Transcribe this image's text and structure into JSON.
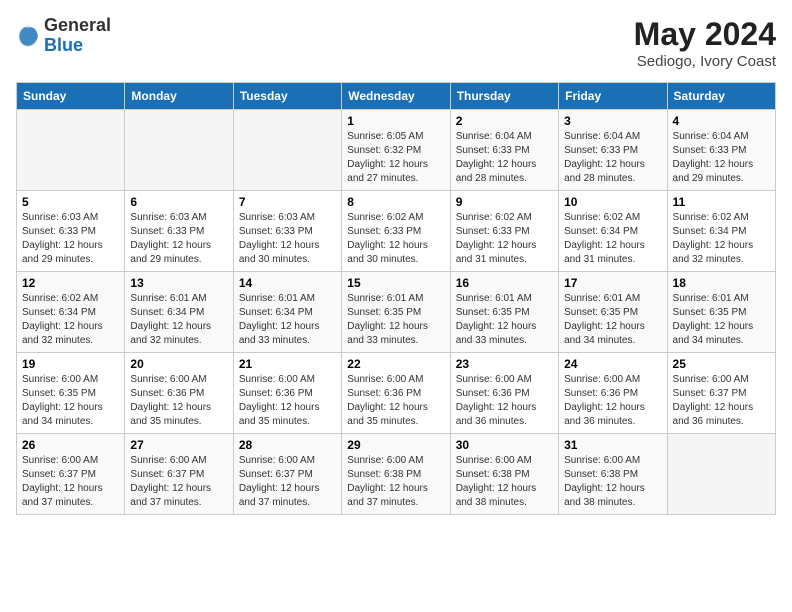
{
  "header": {
    "logo": {
      "general": "General",
      "blue": "Blue"
    },
    "title": "May 2024",
    "location": "Sediogo, Ivory Coast"
  },
  "days_of_week": [
    "Sunday",
    "Monday",
    "Tuesday",
    "Wednesday",
    "Thursday",
    "Friday",
    "Saturday"
  ],
  "weeks": [
    [
      {
        "day": "",
        "info": ""
      },
      {
        "day": "",
        "info": ""
      },
      {
        "day": "",
        "info": ""
      },
      {
        "day": "1",
        "info": "Sunrise: 6:05 AM\nSunset: 6:32 PM\nDaylight: 12 hours and 27 minutes."
      },
      {
        "day": "2",
        "info": "Sunrise: 6:04 AM\nSunset: 6:33 PM\nDaylight: 12 hours and 28 minutes."
      },
      {
        "day": "3",
        "info": "Sunrise: 6:04 AM\nSunset: 6:33 PM\nDaylight: 12 hours and 28 minutes."
      },
      {
        "day": "4",
        "info": "Sunrise: 6:04 AM\nSunset: 6:33 PM\nDaylight: 12 hours and 29 minutes."
      }
    ],
    [
      {
        "day": "5",
        "info": "Sunrise: 6:03 AM\nSunset: 6:33 PM\nDaylight: 12 hours and 29 minutes."
      },
      {
        "day": "6",
        "info": "Sunrise: 6:03 AM\nSunset: 6:33 PM\nDaylight: 12 hours and 29 minutes."
      },
      {
        "day": "7",
        "info": "Sunrise: 6:03 AM\nSunset: 6:33 PM\nDaylight: 12 hours and 30 minutes."
      },
      {
        "day": "8",
        "info": "Sunrise: 6:02 AM\nSunset: 6:33 PM\nDaylight: 12 hours and 30 minutes."
      },
      {
        "day": "9",
        "info": "Sunrise: 6:02 AM\nSunset: 6:33 PM\nDaylight: 12 hours and 31 minutes."
      },
      {
        "day": "10",
        "info": "Sunrise: 6:02 AM\nSunset: 6:34 PM\nDaylight: 12 hours and 31 minutes."
      },
      {
        "day": "11",
        "info": "Sunrise: 6:02 AM\nSunset: 6:34 PM\nDaylight: 12 hours and 32 minutes."
      }
    ],
    [
      {
        "day": "12",
        "info": "Sunrise: 6:02 AM\nSunset: 6:34 PM\nDaylight: 12 hours and 32 minutes."
      },
      {
        "day": "13",
        "info": "Sunrise: 6:01 AM\nSunset: 6:34 PM\nDaylight: 12 hours and 32 minutes."
      },
      {
        "day": "14",
        "info": "Sunrise: 6:01 AM\nSunset: 6:34 PM\nDaylight: 12 hours and 33 minutes."
      },
      {
        "day": "15",
        "info": "Sunrise: 6:01 AM\nSunset: 6:35 PM\nDaylight: 12 hours and 33 minutes."
      },
      {
        "day": "16",
        "info": "Sunrise: 6:01 AM\nSunset: 6:35 PM\nDaylight: 12 hours and 33 minutes."
      },
      {
        "day": "17",
        "info": "Sunrise: 6:01 AM\nSunset: 6:35 PM\nDaylight: 12 hours and 34 minutes."
      },
      {
        "day": "18",
        "info": "Sunrise: 6:01 AM\nSunset: 6:35 PM\nDaylight: 12 hours and 34 minutes."
      }
    ],
    [
      {
        "day": "19",
        "info": "Sunrise: 6:00 AM\nSunset: 6:35 PM\nDaylight: 12 hours and 34 minutes."
      },
      {
        "day": "20",
        "info": "Sunrise: 6:00 AM\nSunset: 6:36 PM\nDaylight: 12 hours and 35 minutes."
      },
      {
        "day": "21",
        "info": "Sunrise: 6:00 AM\nSunset: 6:36 PM\nDaylight: 12 hours and 35 minutes."
      },
      {
        "day": "22",
        "info": "Sunrise: 6:00 AM\nSunset: 6:36 PM\nDaylight: 12 hours and 35 minutes."
      },
      {
        "day": "23",
        "info": "Sunrise: 6:00 AM\nSunset: 6:36 PM\nDaylight: 12 hours and 36 minutes."
      },
      {
        "day": "24",
        "info": "Sunrise: 6:00 AM\nSunset: 6:36 PM\nDaylight: 12 hours and 36 minutes."
      },
      {
        "day": "25",
        "info": "Sunrise: 6:00 AM\nSunset: 6:37 PM\nDaylight: 12 hours and 36 minutes."
      }
    ],
    [
      {
        "day": "26",
        "info": "Sunrise: 6:00 AM\nSunset: 6:37 PM\nDaylight: 12 hours and 37 minutes."
      },
      {
        "day": "27",
        "info": "Sunrise: 6:00 AM\nSunset: 6:37 PM\nDaylight: 12 hours and 37 minutes."
      },
      {
        "day": "28",
        "info": "Sunrise: 6:00 AM\nSunset: 6:37 PM\nDaylight: 12 hours and 37 minutes."
      },
      {
        "day": "29",
        "info": "Sunrise: 6:00 AM\nSunset: 6:38 PM\nDaylight: 12 hours and 37 minutes."
      },
      {
        "day": "30",
        "info": "Sunrise: 6:00 AM\nSunset: 6:38 PM\nDaylight: 12 hours and 38 minutes."
      },
      {
        "day": "31",
        "info": "Sunrise: 6:00 AM\nSunset: 6:38 PM\nDaylight: 12 hours and 38 minutes."
      },
      {
        "day": "",
        "info": ""
      }
    ]
  ]
}
